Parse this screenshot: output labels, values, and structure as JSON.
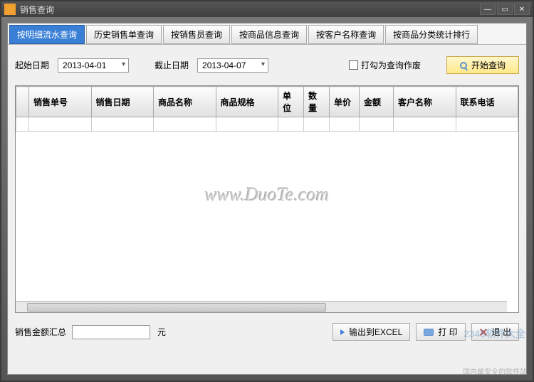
{
  "window": {
    "title": "销售查询"
  },
  "tabs": [
    "按明细流水查询",
    "历史销售单查询",
    "按销售员查询",
    "按商品信息查询",
    "按客户名称查询",
    "按商品分类统计排行"
  ],
  "filters": {
    "start_label": "起始日期",
    "start_value": "2013-04-01",
    "end_label": "截止日期",
    "end_value": "2013-04-07",
    "void_label": "打勾为查询作废",
    "query_btn": "开始查询"
  },
  "table": {
    "columns": [
      "销售单号",
      "销售日期",
      "商品名称",
      "商品规格",
      "单位",
      "数量",
      "单价",
      "金额",
      "客户名称",
      "联系电话"
    ]
  },
  "watermark": "www.DuoTe.com",
  "footer": {
    "sum_label": "销售金额汇总",
    "sum_value": "",
    "unit": "元",
    "export_btn": "输出到EXCEL",
    "print_btn": "打 印",
    "exit_btn": "退 出"
  },
  "branding": {
    "site_label": "2345软件大全",
    "tagline": "国内最安全的软件站"
  }
}
